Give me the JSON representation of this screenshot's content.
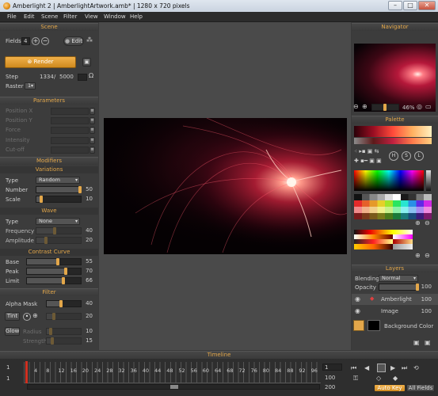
{
  "window": {
    "title": "Amberlight 2 | AmberlightArtwork.amb* | 1280 x 720 pixels",
    "min": "–",
    "max": "□",
    "close": "✕"
  },
  "menu": [
    "File",
    "Edit",
    "Scene",
    "Filter",
    "View",
    "Window",
    "Help"
  ],
  "scene": {
    "title": "Scene",
    "fields_label": "Fields",
    "fields_value": "4",
    "edit_label": "Edit",
    "render_label": "Render",
    "step_label": "Step",
    "step_value": "1334",
    "step_sep": "/",
    "step_total": "5000",
    "raster_label": "Raster",
    "raster_value": "1"
  },
  "parameters": {
    "title": "Parameters",
    "items": [
      "Position X",
      "Position Y",
      "Force",
      "Intensity",
      "Cut-off"
    ]
  },
  "modifiers": {
    "title": "Modifiers",
    "variations": {
      "title": "Variations",
      "type_label": "Type",
      "type_value": "Random",
      "number_label": "Number",
      "number_value": "50",
      "number_level": 1.0,
      "scale_label": "Scale",
      "scale_value": "10",
      "scale_level": 0.1
    },
    "wave": {
      "title": "Wave",
      "type_label": "Type",
      "type_value": "None",
      "frequency_label": "Frequency",
      "frequency_value": "40",
      "frequency_level": 0.4,
      "amplitude_label": "Amplitude",
      "amplitude_value": "20",
      "amplitude_level": 0.2
    },
    "contrast": {
      "title": "Contrast Curve",
      "base_label": "Base",
      "base_value": "55",
      "base_level": 0.55,
      "peak_label": "Peak",
      "peak_value": "70",
      "peak_level": 0.7,
      "limit_label": "Limit",
      "limit_value": "66",
      "limit_level": 0.66
    }
  },
  "filter": {
    "title": "Filter",
    "alpha_label": "Alpha Mask",
    "alpha_value": "40",
    "alpha_level": 0.4,
    "tint_label": "Tint",
    "tint_value": "20",
    "tint_level": 0.2,
    "glow_label": "Glow",
    "radius_label": "Radius",
    "radius_value": "10",
    "radius_level": 0.1,
    "strength_label": "Strength",
    "strength_value": "15",
    "strength_level": 0.15
  },
  "navigator": {
    "title": "Navigator",
    "zoom": "46%"
  },
  "palette": {
    "title": "Palette",
    "h_label": "H",
    "s_label": "S",
    "l_label": "L"
  },
  "layers": {
    "title": "Layers",
    "blending_label": "Blending",
    "blending_value": "Normal",
    "opacity_label": "Opacity",
    "opacity_value": "100",
    "items": [
      {
        "name": "Amberlight",
        "value": "100"
      },
      {
        "name": "Image",
        "value": "100"
      }
    ],
    "background_label": "Background Color"
  },
  "timeline": {
    "title": "Timeline",
    "row1_left": "1",
    "row2_left": "1",
    "ticks": [
      "4",
      "8",
      "12",
      "16",
      "20",
      "24",
      "28",
      "32",
      "36",
      "40",
      "44",
      "48",
      "52",
      "56",
      "60",
      "64",
      "68",
      "72",
      "76",
      "80",
      "84",
      "88",
      "92",
      "96"
    ],
    "frame_value": "1",
    "frame_total": "100",
    "end_value": "200",
    "autokey_label": "Auto Key",
    "fields_button": "All Fields"
  },
  "colors": {
    "accent": "#e3a74a",
    "panel_bg": "#3c3c3c",
    "viewport_bg": "#4a4a4a"
  }
}
